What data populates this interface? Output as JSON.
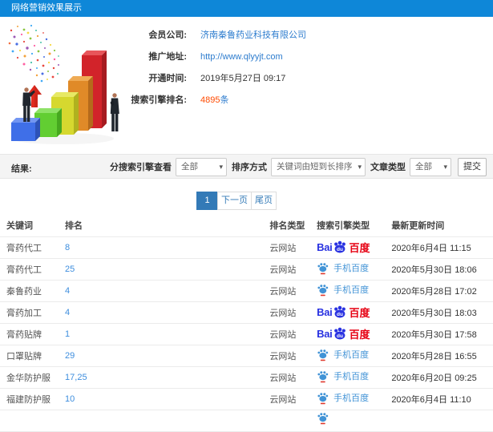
{
  "titlebar": {
    "title": "网络营销效果展示"
  },
  "info": {
    "rows": [
      {
        "label": "会员公司:",
        "value": "济南秦鲁药业科技有限公司"
      },
      {
        "label": "推广地址:",
        "value": "http://www.qlyyjt.com"
      },
      {
        "label": "开通时间:",
        "value": "2019年5月27日 09:17"
      },
      {
        "label": "搜索引擎排名:",
        "value": "4895",
        "unit": "条"
      }
    ]
  },
  "filters": {
    "result_label": "结果:",
    "engine_label": "分搜索引擎查看",
    "engine_value": "全部",
    "sort_label": "排序方式",
    "sort_value": "关键词由短到长排序",
    "type_label": "文章类型",
    "type_value": "全部",
    "submit_label": "提交"
  },
  "pagination": {
    "current": "1",
    "next": "下一页",
    "last": "尾页"
  },
  "table": {
    "headers": [
      "关键词",
      "排名",
      "排名类型",
      "搜索引擎类型",
      "最新更新时间"
    ],
    "baidu_logo": {
      "bai": "Bai",
      "du": "du",
      "cn": "百度"
    },
    "mobile_label": "手机百度",
    "rows": [
      {
        "keyword": "膏药代工",
        "rank": "8",
        "rank_type": "云网站",
        "engine": "baidu",
        "updated": "2020年6月4日 11:15"
      },
      {
        "keyword": "膏药代工",
        "rank": "25",
        "rank_type": "云网站",
        "engine": "mobile",
        "updated": "2020年5月30日 18:06"
      },
      {
        "keyword": "秦鲁药业",
        "rank": "4",
        "rank_type": "云网站",
        "engine": "mobile",
        "updated": "2020年5月28日 17:02"
      },
      {
        "keyword": "膏药加工",
        "rank": "4",
        "rank_type": "云网站",
        "engine": "baidu",
        "updated": "2020年5月30日 18:03"
      },
      {
        "keyword": "膏药贴牌",
        "rank": "1",
        "rank_type": "云网站",
        "engine": "baidu",
        "updated": "2020年5月30日 17:58"
      },
      {
        "keyword": "口罩贴牌",
        "rank": "29",
        "rank_type": "云网站",
        "engine": "mobile",
        "updated": "2020年5月28日 16:55"
      },
      {
        "keyword": "金华防护服",
        "rank": "17,25",
        "rank_type": "云网站",
        "engine": "mobile",
        "updated": "2020年6月20日 09:25"
      },
      {
        "keyword": "福建防护服",
        "rank": "10",
        "rank_type": "云网站",
        "engine": "mobile",
        "updated": "2020年6月4日 11:10"
      },
      {
        "keyword": "",
        "rank": "",
        "rank_type": "",
        "engine": "mobile-partial",
        "updated": ""
      }
    ]
  }
}
